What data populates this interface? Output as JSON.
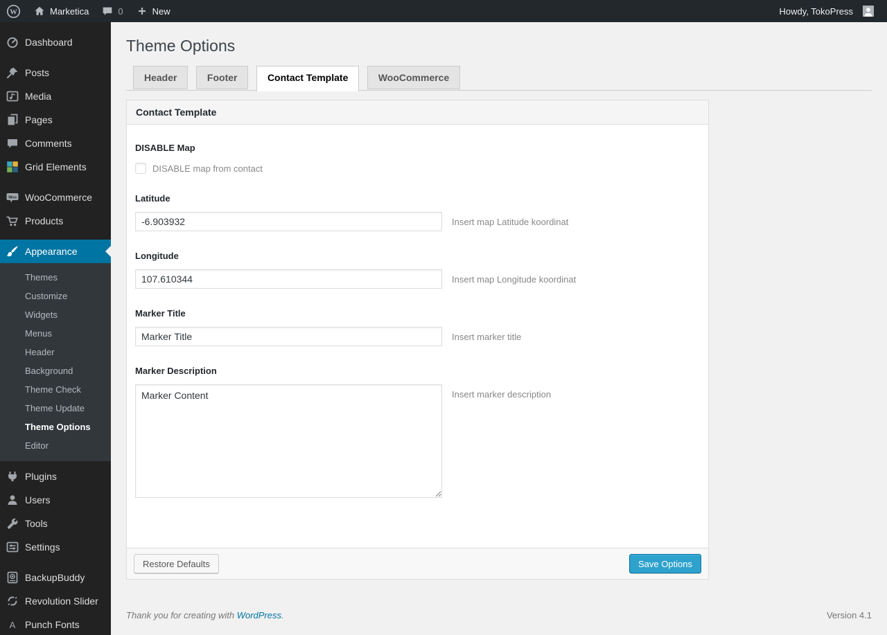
{
  "admin_bar": {
    "site_name": "Marketica",
    "comments_count": "0",
    "new_label": "New",
    "howdy_text": "Howdy, TokoPress"
  },
  "page": {
    "title": "Theme Options"
  },
  "tabs": [
    {
      "label": "Header",
      "active": false
    },
    {
      "label": "Footer",
      "active": false
    },
    {
      "label": "Contact Template",
      "active": true
    },
    {
      "label": "WooCommerce",
      "active": false
    }
  ],
  "panel": {
    "title": "Contact Template",
    "disable_map": {
      "label": "DISABLE Map",
      "checkbox_text": "DISABLE map from contact",
      "checked": false
    },
    "latitude": {
      "label": "Latitude",
      "value": "-6.903932",
      "help": "Insert map Latitude koordinat"
    },
    "longitude": {
      "label": "Longitude",
      "value": "107.610344",
      "help": "Insert map Longitude koordinat"
    },
    "marker_title": {
      "label": "Marker Title",
      "value": "Marker Title",
      "help": "Insert marker title"
    },
    "marker_description": {
      "label": "Marker Description",
      "value": "Marker Content",
      "help": "Insert marker description"
    },
    "restore_button": "Restore Defaults",
    "save_button": "Save Options"
  },
  "sidebar": {
    "items": [
      {
        "label": "Dashboard",
        "icon": "dashboard-icon"
      },
      {
        "label": "Posts",
        "icon": "posts-icon"
      },
      {
        "label": "Media",
        "icon": "media-icon"
      },
      {
        "label": "Pages",
        "icon": "pages-icon"
      },
      {
        "label": "Comments",
        "icon": "comments-icon"
      },
      {
        "label": "Grid Elements",
        "icon": "grid-elements-icon"
      },
      {
        "label": "WooCommerce",
        "icon": "woocommerce-icon"
      },
      {
        "label": "Products",
        "icon": "cart-icon"
      },
      {
        "label": "Appearance",
        "icon": "paintbrush-icon",
        "active": true
      },
      {
        "label": "Plugins",
        "icon": "plugin-icon"
      },
      {
        "label": "Users",
        "icon": "user-icon"
      },
      {
        "label": "Tools",
        "icon": "wrench-icon"
      },
      {
        "label": "Settings",
        "icon": "settings-icon"
      },
      {
        "label": "BackupBuddy",
        "icon": "backup-icon"
      },
      {
        "label": "Revolution Slider",
        "icon": "rotate-icon"
      },
      {
        "label": "Punch Fonts",
        "icon": "font-icon"
      }
    ],
    "appearance_submenu": [
      {
        "label": "Themes"
      },
      {
        "label": "Customize"
      },
      {
        "label": "Widgets"
      },
      {
        "label": "Menus"
      },
      {
        "label": "Header"
      },
      {
        "label": "Background"
      },
      {
        "label": "Theme Check"
      },
      {
        "label": "Theme Update"
      },
      {
        "label": "Theme Options",
        "current": true
      },
      {
        "label": "Editor"
      }
    ]
  },
  "icons": {
    "wp_logo_letter": "W",
    "woocommerce_badge_text": "Woo",
    "punch_fonts_letter": "A"
  },
  "page_footer": {
    "thanks_prefix": "Thank you for creating with ",
    "link_text": "WordPress",
    "thanks_suffix": ".",
    "version": "Version 4.1"
  },
  "colors": {
    "accent": "#0074a2",
    "primary_button": "#2ea2cc",
    "admin_bar_bg": "#23282d",
    "sidebar_bg": "#222222",
    "submenu_bg": "#32373c",
    "page_bg": "#f1f1f1",
    "link": "#0074a2"
  }
}
